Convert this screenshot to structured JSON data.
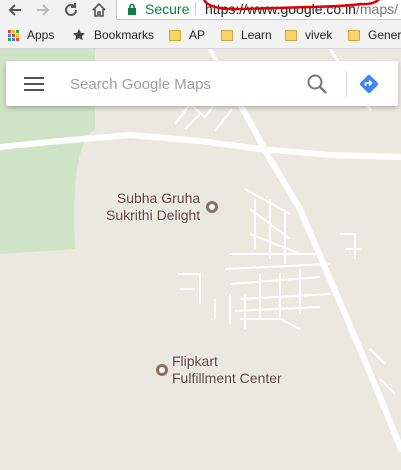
{
  "browser": {
    "secure_label": "Secure",
    "url_main": "https://www.google.co.in",
    "url_path": "/maps/",
    "bookmarks": [
      {
        "label": "Apps",
        "icon": "apps-grid-icon"
      },
      {
        "label": "Bookmarks",
        "icon": "star-icon"
      },
      {
        "label": "AP",
        "icon": "folder-icon"
      },
      {
        "label": "Learn",
        "icon": "folder-icon"
      },
      {
        "label": "vivek",
        "icon": "folder-icon"
      },
      {
        "label": "Gener",
        "icon": "folder-icon"
      }
    ]
  },
  "search": {
    "placeholder": "Search Google Maps"
  },
  "map": {
    "places": [
      {
        "line1": "Subha Gruha",
        "line2": "Sukrithi Delight"
      },
      {
        "line1": "Flipkart",
        "line2": "Fulfillment Center"
      }
    ],
    "colors": {
      "land": "#ebe8df",
      "park": "#cfe3c7",
      "road": "#ffffff",
      "poi": "#8d6e63",
      "annotation_scribble": "#e00000"
    }
  }
}
